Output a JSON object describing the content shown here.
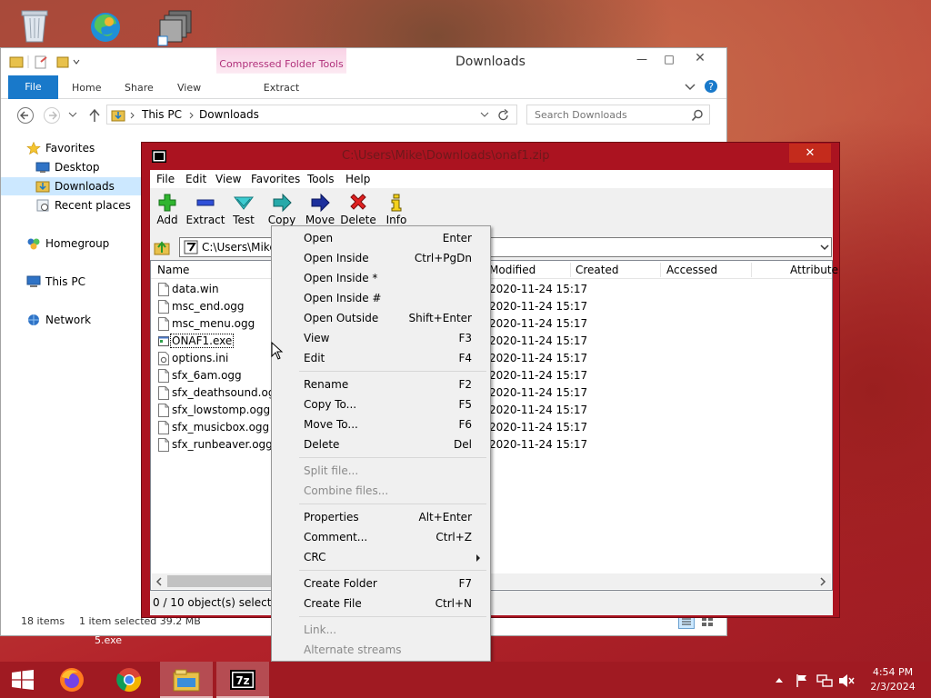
{
  "explorer": {
    "title": "Downloads",
    "context_tab": "Compressed Folder Tools",
    "context_subtab": "Extract",
    "ribbon_tabs": [
      "File",
      "Home",
      "Share",
      "View"
    ],
    "breadcrumb": [
      "This PC",
      "Downloads"
    ],
    "search_placeholder": "Search Downloads",
    "nav": {
      "favorites": "Favorites",
      "desktop": "Desktop",
      "downloads": "Downloads",
      "recent": "Recent places",
      "homegroup": "Homegroup",
      "thispc": "This PC",
      "network": "Network"
    },
    "status_items": "18 items",
    "status_selected": "1 item selected  39.2 MB",
    "behind_file": "5.exe"
  },
  "sevenzip": {
    "title_path": "C:\\Users\\Mike\\Downloads\\onaf1.zip",
    "menu": [
      "File",
      "Edit",
      "View",
      "Favorites",
      "Tools",
      "Help"
    ],
    "toolbar": [
      "Add",
      "Extract",
      "Test",
      "Copy",
      "Move",
      "Delete",
      "Info"
    ],
    "path": "C:\\Users\\Mike",
    "columns": [
      "Name",
      "Modified",
      "Created",
      "Accessed",
      "Attribute"
    ],
    "files": [
      {
        "name": "data.win",
        "modified": "2020-11-24 15:17"
      },
      {
        "name": "msc_end.ogg",
        "modified": "2020-11-24 15:17"
      },
      {
        "name": "msc_menu.ogg",
        "modified": "2020-11-24 15:17"
      },
      {
        "name": "ONAF1.exe",
        "modified": "2020-11-24 15:17"
      },
      {
        "name": "options.ini",
        "modified": "2020-11-24 15:17"
      },
      {
        "name": "sfx_6am.ogg",
        "modified": "2020-11-24 15:17"
      },
      {
        "name": "sfx_deathsound.ogg",
        "modified": "2020-11-24 15:17"
      },
      {
        "name": "sfx_lowstomp.ogg",
        "modified": "2020-11-24 15:17"
      },
      {
        "name": "sfx_musicbox.ogg",
        "modified": "2020-11-24 15:17"
      },
      {
        "name": "sfx_runbeaver.ogg",
        "modified": "2020-11-24 15:17"
      }
    ],
    "status": "0 / 10 object(s) selected"
  },
  "context_menu": {
    "items": [
      {
        "label": "Open",
        "shortcut": "Enter"
      },
      {
        "label": "Open Inside",
        "shortcut": "Ctrl+PgDn"
      },
      {
        "label": "Open Inside *",
        "shortcut": ""
      },
      {
        "label": "Open Inside #",
        "shortcut": ""
      },
      {
        "label": "Open Outside",
        "shortcut": "Shift+Enter"
      },
      {
        "label": "View",
        "shortcut": "F3"
      },
      {
        "label": "Edit",
        "shortcut": "F4"
      },
      {
        "label": "Rename",
        "shortcut": "F2"
      },
      {
        "label": "Copy To...",
        "shortcut": "F5"
      },
      {
        "label": "Move To...",
        "shortcut": "F6"
      },
      {
        "label": "Delete",
        "shortcut": "Del"
      },
      {
        "label": "Split file...",
        "shortcut": ""
      },
      {
        "label": "Combine files...",
        "shortcut": ""
      },
      {
        "label": "Properties",
        "shortcut": "Alt+Enter"
      },
      {
        "label": "Comment...",
        "shortcut": "Ctrl+Z"
      },
      {
        "label": "CRC",
        "shortcut": ""
      },
      {
        "label": "Create Folder",
        "shortcut": "F7"
      },
      {
        "label": "Create File",
        "shortcut": "Ctrl+N"
      },
      {
        "label": "Link...",
        "shortcut": ""
      },
      {
        "label": "Alternate streams",
        "shortcut": ""
      }
    ]
  },
  "taskbar": {
    "time": "4:54 PM",
    "date": "2/3/2024",
    "apps": [
      "start-icon",
      "firefox-icon",
      "chrome-icon",
      "file-explorer-icon",
      "7zip-icon"
    ]
  },
  "colors": {
    "accent": "#1979ca",
    "sevenzip_frame": "#ab1320",
    "close_red": "#c42b1c",
    "taskbar": "#a01a22"
  }
}
